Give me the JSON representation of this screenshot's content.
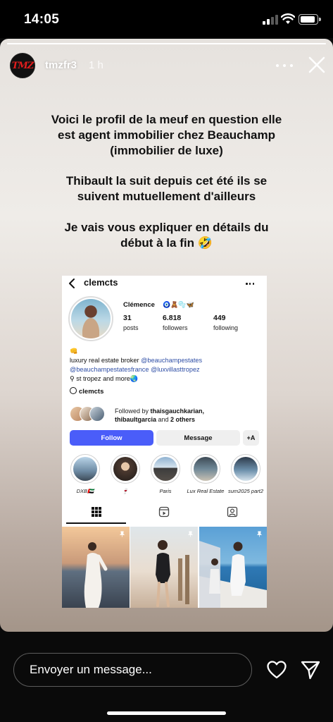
{
  "status_bar": {
    "time": "14:05",
    "battery_fraction": 0.9,
    "signal_bars": 2
  },
  "story": {
    "progress_fraction": 1.0,
    "username": "tmzfr3",
    "posted_ago": "1 h",
    "avatar_text": "TMZ",
    "paragraphs": [
      [
        "Voici le profil de la meuf en question elle",
        "est agent immobilier chez Beauchamp",
        "(immobilier de luxe)"
      ],
      [
        "Thibault la suit depuis cet été ils se",
        "suivent mutuellement d'ailleurs"
      ],
      [
        "Je vais vous expliquer en détails du",
        "début à la fin 🤣"
      ]
    ]
  },
  "profile": {
    "username": "clemcts",
    "name": "Clémence",
    "name_emojis": "🧿🧸🫧🦋",
    "stats": [
      {
        "value": "31",
        "label": "posts"
      },
      {
        "value": "6.818",
        "label": "followers"
      },
      {
        "value": "449",
        "label": "following"
      }
    ],
    "bio": {
      "line0": "👊",
      "line1_prefix": "luxury real estate broker ",
      "line1_link": "@beauchampestates",
      "line2_link_a": "@beauchampestatesfrance",
      "line2_link_b": "@luxvillasttropez",
      "line3": "⚲ st tropez and more🌏"
    },
    "threads_handle": "clemcts",
    "followed_by": {
      "prefix": "Followed by ",
      "user1": "thaisgauchkarian,",
      "user2": "thibaultgarcia",
      "middle": " and ",
      "others": "2 others"
    },
    "buttons": {
      "follow": "Follow",
      "message": "Message",
      "add": "+A"
    },
    "highlights": [
      {
        "label": "DXB🇦🇪"
      },
      {
        "label": "🍷"
      },
      {
        "label": "Paris"
      },
      {
        "label": "Lux Real Estate"
      },
      {
        "label": "sum2025 part2"
      }
    ]
  },
  "composer": {
    "placeholder": "Envoyer un message..."
  },
  "icons": {
    "close": "close-icon",
    "more": "more-dots-icon",
    "heart": "heart-icon",
    "send": "send-icon",
    "grid": "grid-icon",
    "reels": "reels-icon",
    "tagged": "tagged-icon"
  },
  "colors": {
    "follow_button": "#4a5df9",
    "link": "#2f4fa6",
    "tmz_red": "#e11d1d"
  }
}
